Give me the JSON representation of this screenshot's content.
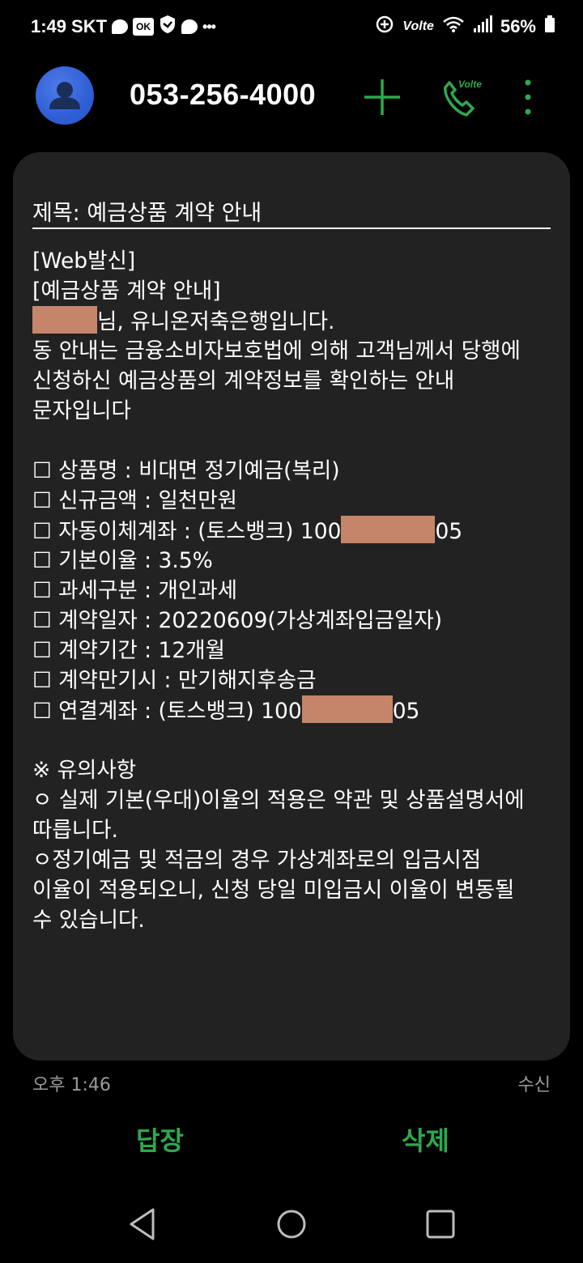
{
  "status_bar": {
    "time": "1:49",
    "carrier": "SKT",
    "ok_icon_text": "OK",
    "volte": "Volte",
    "battery": "56%"
  },
  "header": {
    "phone_number": "053-256-4000",
    "call_volte_label": "Volte"
  },
  "message": {
    "subject": "제목: 예금상품 계약 안내",
    "lines": [
      "[Web발신]",
      "[예금상품 계약 안내]",
      "님, 유니온저축은행입니다.",
      "동 안내는 금융소비자보호법에 의해 고객님께서 당행에",
      "신청하신 예금상품의 계약정보를 확인하는 안내",
      "문자입니다",
      "",
      "☐ 상품명 : 비대면 정기예금(복리)",
      "☐ 신규금액 : 일천만원",
      "☐ 자동이체계좌 : (토스뱅크) 100",
      "05",
      "☐ 기본이율 : 3.5%",
      "☐ 과세구분 : 개인과세",
      "☐ 계약일자 : 20220609(가상계좌입금일자)",
      "☐ 계약기간 : 12개월",
      "☐ 계약만기시 : 만기해지후송금",
      "☐ 연결계좌 : (토스뱅크) 100",
      "05",
      "",
      "※ 유의사항",
      "ㅇ 실제 기본(우대)이율의 적용은 약관 및 상품설명서에",
      "따릅니다.",
      "ㅇ정기예금 및 적금의 경우 가상계좌로의 입금시점",
      "이율이 적용되오니, 신청 당일 미입금시 이율이 변동될",
      "수 있습니다."
    ]
  },
  "meta": {
    "time": "오후 1:46",
    "status": "수신"
  },
  "actions": {
    "reply": "답장",
    "delete": "삭제"
  },
  "colors": {
    "accent": "#2fa84f",
    "card": "#222222",
    "redaction": "#c5856a"
  }
}
